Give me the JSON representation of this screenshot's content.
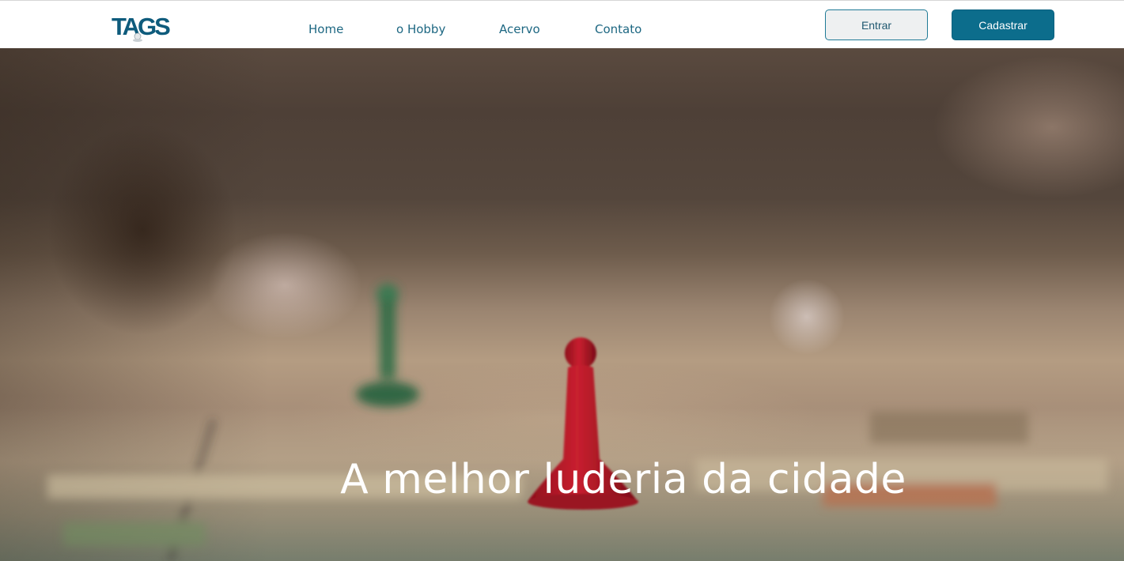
{
  "header": {
    "logo_text": "TAGS",
    "nav": [
      {
        "label": "Home"
      },
      {
        "label": "o Hobby"
      },
      {
        "label": "Acervo"
      },
      {
        "label": "Contato"
      }
    ],
    "login_label": "Entrar",
    "signup_label": "Cadastrar"
  },
  "hero": {
    "title": "A melhor luderia da cidade",
    "image_description_icon": "board-game-pawn-image"
  },
  "colors": {
    "accent": "#0c6d8c",
    "nav_text": "#1d6782",
    "login_bg": "#eef0f1",
    "pawn_red": "#c11f2f",
    "pawn_green": "#1f6b45"
  }
}
